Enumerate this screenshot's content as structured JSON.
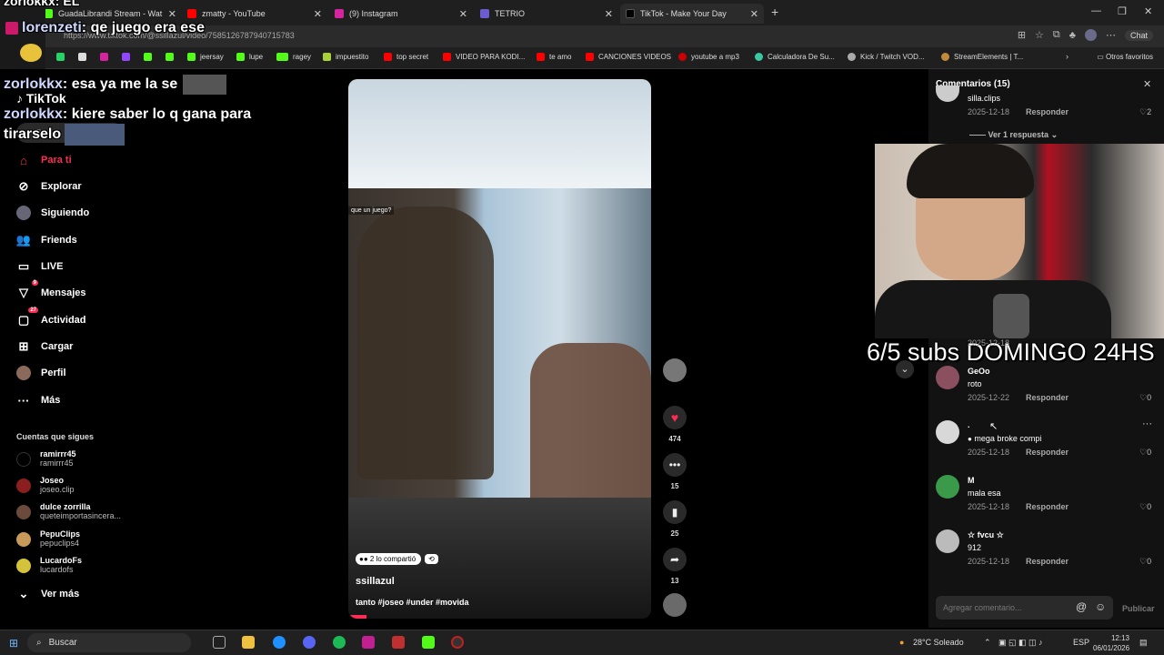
{
  "browser": {
    "tabs": [
      {
        "label": "GuadaLibrandi Stream - Wat",
        "color": "#53fc18"
      },
      {
        "label": "zmatty - YouTube",
        "color": "#ff0000"
      },
      {
        "label": "(9) Instagram",
        "color": "#d6249f"
      },
      {
        "label": "TETRIO",
        "color": "#6d5bd0"
      },
      {
        "label": "TikTok - Make Your Day",
        "color": "#000000"
      }
    ],
    "url": "https://www.tiktok.com/@ssillazul/video/7585126787940715783",
    "chat_label": "Chat",
    "other_bookmarks": "Otros favoritos",
    "bookmarks": [
      "jeersay",
      "lupe",
      "ragey",
      "impuestito",
      "top secret",
      "VIDEO PARA KODI...",
      "te amo",
      "CANCIONES VIDEOS",
      "youtube a mp3",
      "Calculadora De Su...",
      "Kick / Twitch VOD...",
      "StreamElements | T..."
    ]
  },
  "overlay_chat": [
    {
      "user": "lorenzeti",
      "text": "qe juego era ese"
    },
    {
      "user": "zorlokkx",
      "text": "esa ya me la se"
    },
    {
      "user": "zorlokkx",
      "text": "kiere saber lo q gana para tirarselo"
    }
  ],
  "overlay_partial_top": "zorlokkx: EL",
  "tiktok": {
    "logo": "TikTok",
    "search_placeholder": "Buscar",
    "nav": [
      {
        "label": "Para ti",
        "icon": "home-icon",
        "badge": ""
      },
      {
        "label": "Explorar",
        "icon": "compass-icon",
        "badge": ""
      },
      {
        "label": "Siguiendo",
        "icon": "following-icon",
        "badge": ""
      },
      {
        "label": "Friends",
        "icon": "friends-icon",
        "badge": ""
      },
      {
        "label": "LIVE",
        "icon": "live-icon",
        "badge": ""
      },
      {
        "label": "Mensajes",
        "icon": "message-icon",
        "badge": "9"
      },
      {
        "label": "Actividad",
        "icon": "activity-icon",
        "badge": "27"
      },
      {
        "label": "Cargar",
        "icon": "upload-icon",
        "badge": ""
      },
      {
        "label": "Perfil",
        "icon": "profile-icon",
        "badge": ""
      },
      {
        "label": "Más",
        "icon": "more-icon",
        "badge": ""
      }
    ],
    "following_title": "Cuentas que sigues",
    "following": [
      {
        "name": "ramirrr45",
        "handle": "ramirrr45",
        "color": "#000000"
      },
      {
        "name": "Joseo",
        "handle": "joseo.clip",
        "color": "#8b1e1e"
      },
      {
        "name": "dulce zorrilla",
        "handle": "queteimportasincera...",
        "color": "#6a4a3a"
      },
      {
        "name": "PepuClips",
        "handle": "pepuclips4",
        "color": "#c89a5a"
      },
      {
        "name": "LucardoFs",
        "handle": "lucardofs",
        "color": "#d4c23a"
      }
    ],
    "see_more": "Ver más",
    "video": {
      "shared_label": "2 lo compartió",
      "author": "ssillazul",
      "caption": "tanto #joseo #under #movida",
      "overlay_text": "que un juego?",
      "likes": "474",
      "comments": "15",
      "saves": "25",
      "shares": "13"
    },
    "comments_panel": {
      "title": "Comentarios (15)",
      "reply_label": "Responder",
      "view_replies": "Ver 1 respuesta",
      "input_placeholder": "Agregar comentario...",
      "publish": "Publicar",
      "items": [
        {
          "name": "",
          "text": "silla.clips",
          "date": "2025-12-18",
          "likes": "2"
        },
        {
          "name": "GeOo",
          "text": "roto",
          "date": "2025-12-22",
          "likes": "0"
        },
        {
          "name": ".",
          "text": "mega broke compi",
          "date": "2025-12-18",
          "likes": "0"
        },
        {
          "name": "M",
          "text": "mala esa",
          "date": "2025-12-18",
          "likes": "0"
        },
        {
          "name": "☆ fvcu ☆",
          "text": "912",
          "date": "2025-12-18",
          "likes": "0"
        }
      ],
      "hidden_date": "2025-12-18"
    }
  },
  "stream_overlay": {
    "subs_text": "6/5 subs DOMINGO 24HS"
  },
  "taskbar": {
    "search": "Buscar",
    "weather": "28°C Soleado",
    "lang": "ESP",
    "time": "12:13",
    "date": "06/01/2026"
  }
}
